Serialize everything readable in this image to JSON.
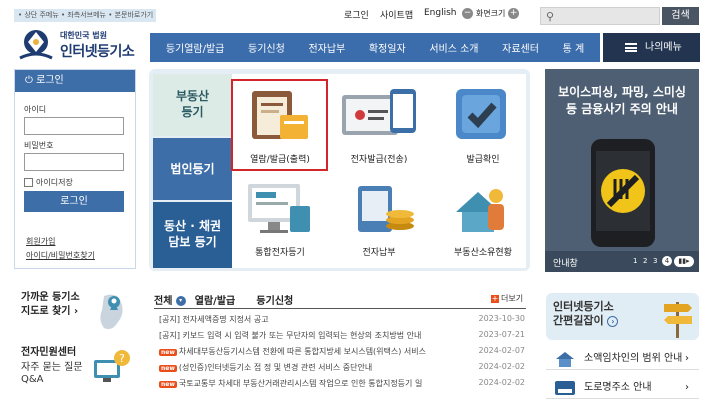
{
  "topbar": {
    "skip": "• 상단 주메뉴 • 좌측서브메뉴 • 본문바로가기",
    "login": "로그인",
    "sitemap": "사이트맵",
    "english": "English",
    "screen_size": "화면크기",
    "minus": "−",
    "plus": "+",
    "search_btn": "검색"
  },
  "logo": {
    "small": "대한민국 법원",
    "big": "인터넷등기소"
  },
  "nav": {
    "items": [
      "등기열람/발급",
      "등기신청",
      "전자납부",
      "확정일자",
      "서비스 소개",
      "자료센터",
      "통 계"
    ],
    "mymenu": "나의메뉴"
  },
  "login": {
    "title": "로그인",
    "id_label": "아이디",
    "pw_label": "비밀번호",
    "save_id": "아이디저장",
    "button": "로그인",
    "join": "회원가입",
    "find": "아이디/비밀번호찾기"
  },
  "categories": {
    "realty_1": "부동산",
    "realty_2": "등기",
    "corp": "법인등기",
    "movable_1": "동산 · 채권",
    "movable_2": "담보 등기"
  },
  "services": [
    "열람/발급(출력)",
    "전자발급(전송)",
    "발급확인",
    "통합전자등기",
    "전자납부",
    "부동산소유현황"
  ],
  "banner": {
    "title_1": "보이스피싱, 파밍, 스미싱",
    "title_2": "등 금융사기 주의 안내",
    "footer": "안내창",
    "pages": [
      "1",
      "2",
      "3",
      "4"
    ]
  },
  "map": {
    "line1": "가까운 등기소",
    "line2": "지도로 찾기"
  },
  "civil": {
    "title": "전자민원센터",
    "faq1": "자주 묻는 질문",
    "faq2": "Q&A"
  },
  "notices": {
    "tabs": [
      "전체",
      "열람/발급",
      "등기신청"
    ],
    "more": "더보기",
    "items": [
      {
        "new": false,
        "text": "[공지] 전자세액증명 지정서 공고",
        "date": "2023-10-30"
      },
      {
        "new": false,
        "text": "[공지] 키보드 입력 시 입력 불가 또는 무단자의 입력되는 현상의 조치방법 안내",
        "date": "2023-07-21"
      },
      {
        "new": true,
        "text": "차세대부동산등기시스템 전환에 따른 통합지방세 보시스템(위택스) 서비스",
        "date": "2024-02-07"
      },
      {
        "new": true,
        "text": "(성인증)인터넷등기소 접 정 및 변경 관련 서비스 중단안내",
        "date": "2024-02-02"
      },
      {
        "new": true,
        "text": "국토교통부 차세대 부동산거래관리시스템 작업으로 인한 통합지정등기 일",
        "date": "2024-02-02"
      }
    ]
  },
  "guide": {
    "line1": "인터넷등기소",
    "line2": "간편길잡이"
  },
  "links": [
    "소액임차인의 범위 안내",
    "도로명주소 안내"
  ],
  "colors": {
    "nav": "#3b6cab",
    "highlight": "#d3262b",
    "banner": "#4e5f73"
  }
}
